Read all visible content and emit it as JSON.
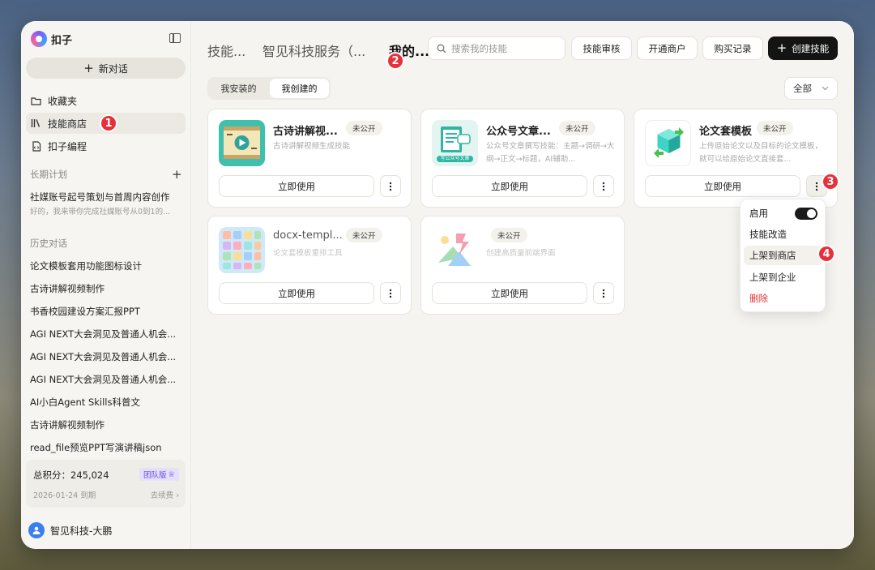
{
  "app": {
    "name": "扣子"
  },
  "sidebar": {
    "new_chat": "新对话",
    "nav": [
      {
        "label": "收藏夹",
        "icon": "folder-icon"
      },
      {
        "label": "技能商店",
        "icon": "books-icon",
        "active": true
      },
      {
        "label": "扣子编程",
        "icon": "code-file-icon"
      }
    ],
    "long_term_label": "长期计划",
    "plan": {
      "title": "社媒账号起号策划与首周内容创作",
      "subtitle": "好的，我来带你完成社媒账号从0到1的..."
    },
    "history_label": "历史对话",
    "history": [
      "论文模板套用功能图标设计",
      "古诗讲解视频制作",
      "书香校园建设方案汇报PPT",
      "AGI NEXT大会洞见及普通人机会...",
      "AGI NEXT大会洞见及普通人机会...",
      "AGI NEXT大会洞见及普通人机会...",
      "AI小白Agent Skills科普文",
      "古诗讲解视频制作",
      "read_file预览PPT写演讲稿json"
    ],
    "points": {
      "label": "总积分：245,024",
      "plan_badge": "团队版",
      "expire": "2026-01-24 到期",
      "renew": "去续费"
    },
    "user": {
      "name": "智见科技-大鹏"
    }
  },
  "header": {
    "tabs": [
      "技能...",
      "智见科技服务（...",
      "我的..."
    ],
    "active_tab": 2,
    "search_placeholder": "搜索我的技能",
    "buttons": {
      "review": "技能审核",
      "merchant": "开通商户",
      "purchases": "购买记录",
      "create": "创建技能"
    }
  },
  "segment": {
    "installed": "我安装的",
    "created": "我创建的",
    "active": "我创建的"
  },
  "filter": {
    "value": "全部"
  },
  "cards": [
    {
      "title": "古诗讲解视...",
      "status": "未公开",
      "desc": "古诗讲解视频生成技能",
      "use": "立即使用",
      "icon": "ancient-poem-video-icon"
    },
    {
      "title": "公众号文章...",
      "status": "未公开",
      "desc": "公众号文章撰写技能：主题→调研→大纲→正文→标题，AI辅助...",
      "use": "立即使用",
      "icon": "wechat-article-icon",
      "icon_caption": "写公众号文章"
    },
    {
      "title": "论文套模板",
      "status": "未公开",
      "desc": "上传原始论文以及目标的论文模板，就可以给原始论文直接套...",
      "use": "立即使用",
      "icon": "paper-template-cube-icon"
    },
    {
      "title": "docx-templ...",
      "status": "未公开",
      "desc": "论文套模板重排工具",
      "use": "立即使用",
      "icon": "app-grid-icon"
    },
    {
      "title": "",
      "status": "未公开",
      "desc": "创建高质量前端界面",
      "use": "立即使用",
      "icon": "frontend-design-icon"
    }
  ],
  "menu": {
    "items": [
      "启用",
      "技能改造",
      "上架到商店",
      "上架到企业",
      "删除"
    ],
    "enabled": true
  },
  "annotations": [
    "1",
    "2",
    "3",
    "4"
  ],
  "colors": {
    "accent": "#141414",
    "danger": "#e33030",
    "marker": "#e8303a",
    "team_badge": "#6a4fd9"
  }
}
